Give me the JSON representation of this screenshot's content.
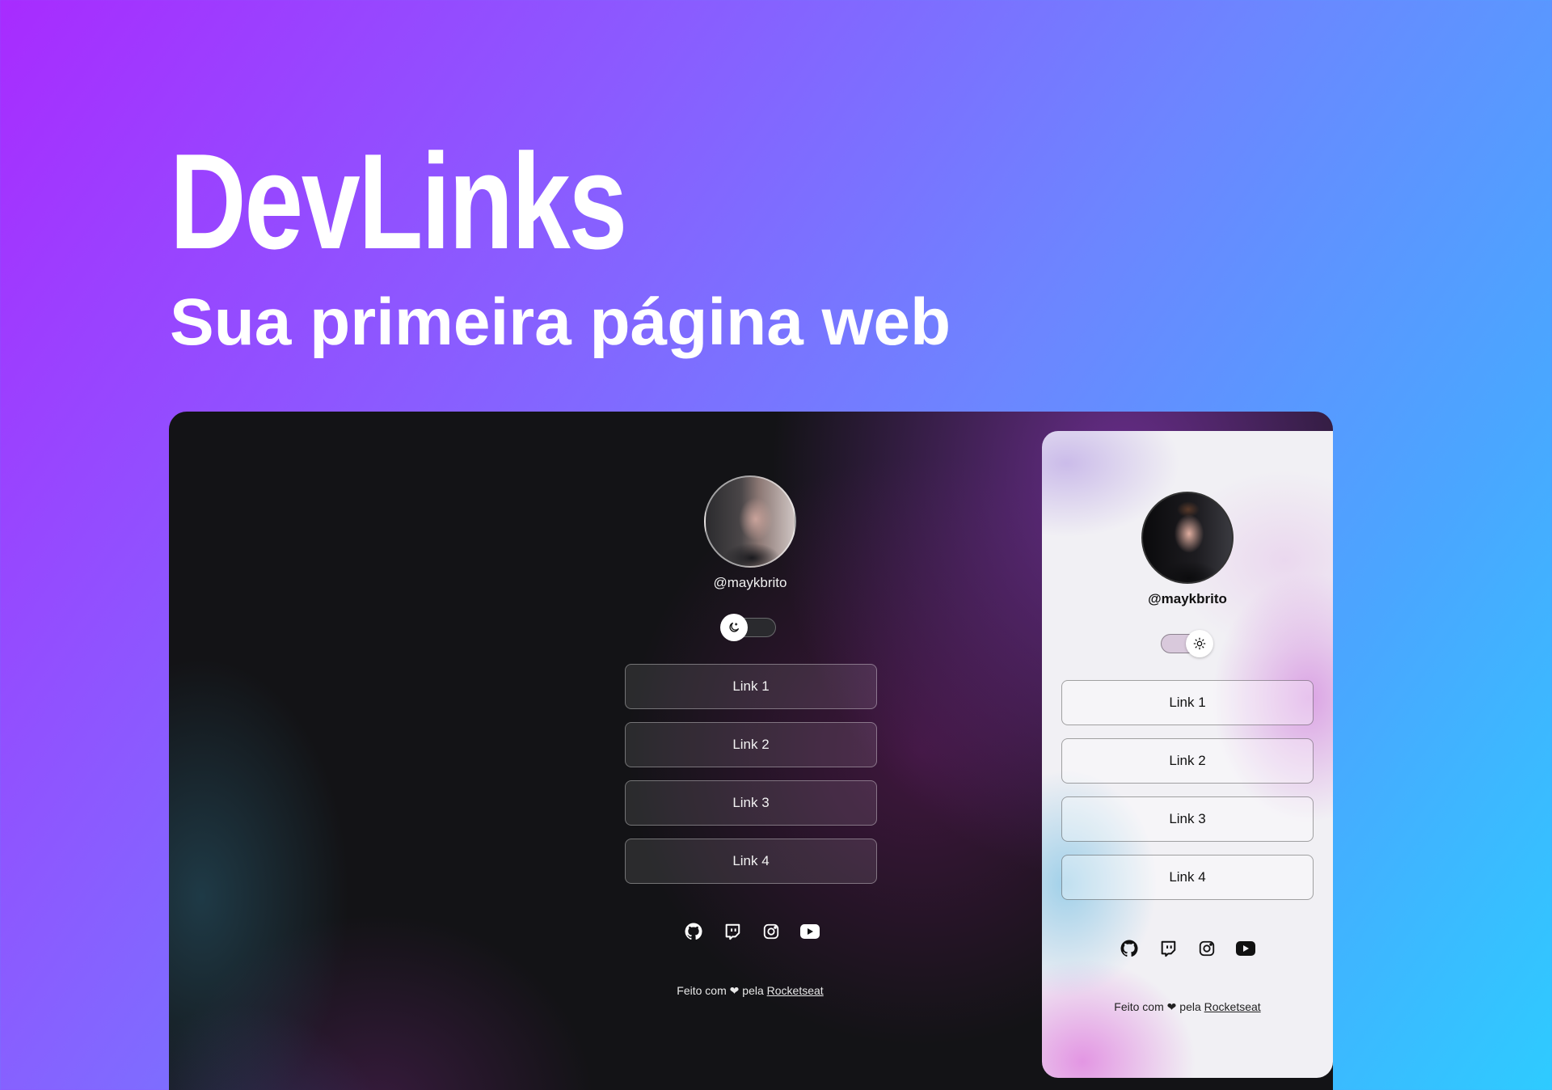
{
  "hero": {
    "title": "DevLinks",
    "subtitle": "Sua primeira página web"
  },
  "dark_preview": {
    "username": "@maykbrito",
    "theme_toggle_state": "dark",
    "links": [
      "Link 1",
      "Link 2",
      "Link 3",
      "Link 4"
    ],
    "socials": [
      "github-icon",
      "twitch-icon",
      "instagram-icon",
      "youtube-icon"
    ],
    "footer": {
      "prefix": "Feito com",
      "middle": "pela",
      "link": "Rocketseat"
    },
    "colors": {
      "background": "#131316",
      "accent": "#782fa0",
      "text": "#f0f0f0"
    }
  },
  "light_preview": {
    "username": "@maykbrito",
    "theme_toggle_state": "light",
    "links": [
      "Link 1",
      "Link 2",
      "Link 3",
      "Link 4"
    ],
    "socials": [
      "github-icon",
      "twitch-icon",
      "instagram-icon",
      "youtube-icon"
    ],
    "footer": {
      "prefix": "Feito com",
      "middle": "pela",
      "link": "Rocketseat"
    },
    "colors": {
      "background": "#f1f0f4",
      "accent": "#d796e1",
      "text": "#111111"
    }
  }
}
